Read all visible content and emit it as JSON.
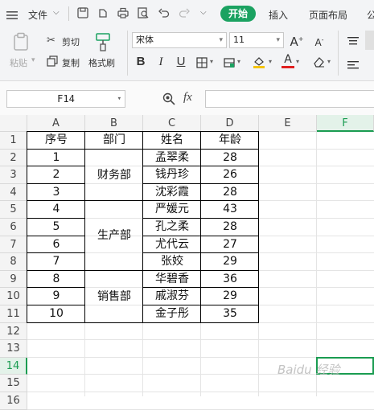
{
  "menubar": {
    "file_label": "文件",
    "tabs": [
      {
        "label": "开始",
        "active": true
      },
      {
        "label": "插入",
        "active": false
      },
      {
        "label": "页面布局",
        "active": false
      },
      {
        "label": "公",
        "active": false
      }
    ]
  },
  "ribbon": {
    "paste_label": "粘贴",
    "cut_label": "剪切",
    "copy_label": "复制",
    "format_painter_label": "格式刷",
    "font_name": "宋体",
    "font_size": "11",
    "font_color": "#e02020",
    "fill_color": "#f5c400"
  },
  "formula_bar": {
    "name_box": "F14",
    "fx_label": "fx",
    "content": ""
  },
  "sheet": {
    "columns": [
      "A",
      "B",
      "C",
      "D",
      "E",
      "F"
    ],
    "rows": [
      "1",
      "2",
      "3",
      "4",
      "5",
      "6",
      "7",
      "8",
      "9",
      "10",
      "11",
      "12",
      "13",
      "14",
      "15",
      "16"
    ],
    "selected_column": "F",
    "selected_row": "14",
    "header": {
      "A": "序号",
      "B": "部门",
      "C": "姓名",
      "D": "年龄"
    },
    "data": [
      {
        "no": "1",
        "name": "孟翠柔",
        "age": "28"
      },
      {
        "no": "2",
        "name": "钱丹珍",
        "age": "26"
      },
      {
        "no": "3",
        "name": "沈彩霞",
        "age": "28"
      },
      {
        "no": "4",
        "name": "严媛元",
        "age": "43"
      },
      {
        "no": "5",
        "name": "孔之柔",
        "age": "28"
      },
      {
        "no": "6",
        "name": "尤代云",
        "age": "27"
      },
      {
        "no": "7",
        "name": "张姣",
        "age": "29"
      },
      {
        "no": "8",
        "name": "华碧香",
        "age": "36"
      },
      {
        "no": "9",
        "name": "戚淑芬",
        "age": "29"
      },
      {
        "no": "10",
        "name": "金子彤",
        "age": "35"
      }
    ],
    "departments": [
      "财务部",
      "生产部",
      "销售部"
    ]
  },
  "watermark": "Baidu 经验"
}
